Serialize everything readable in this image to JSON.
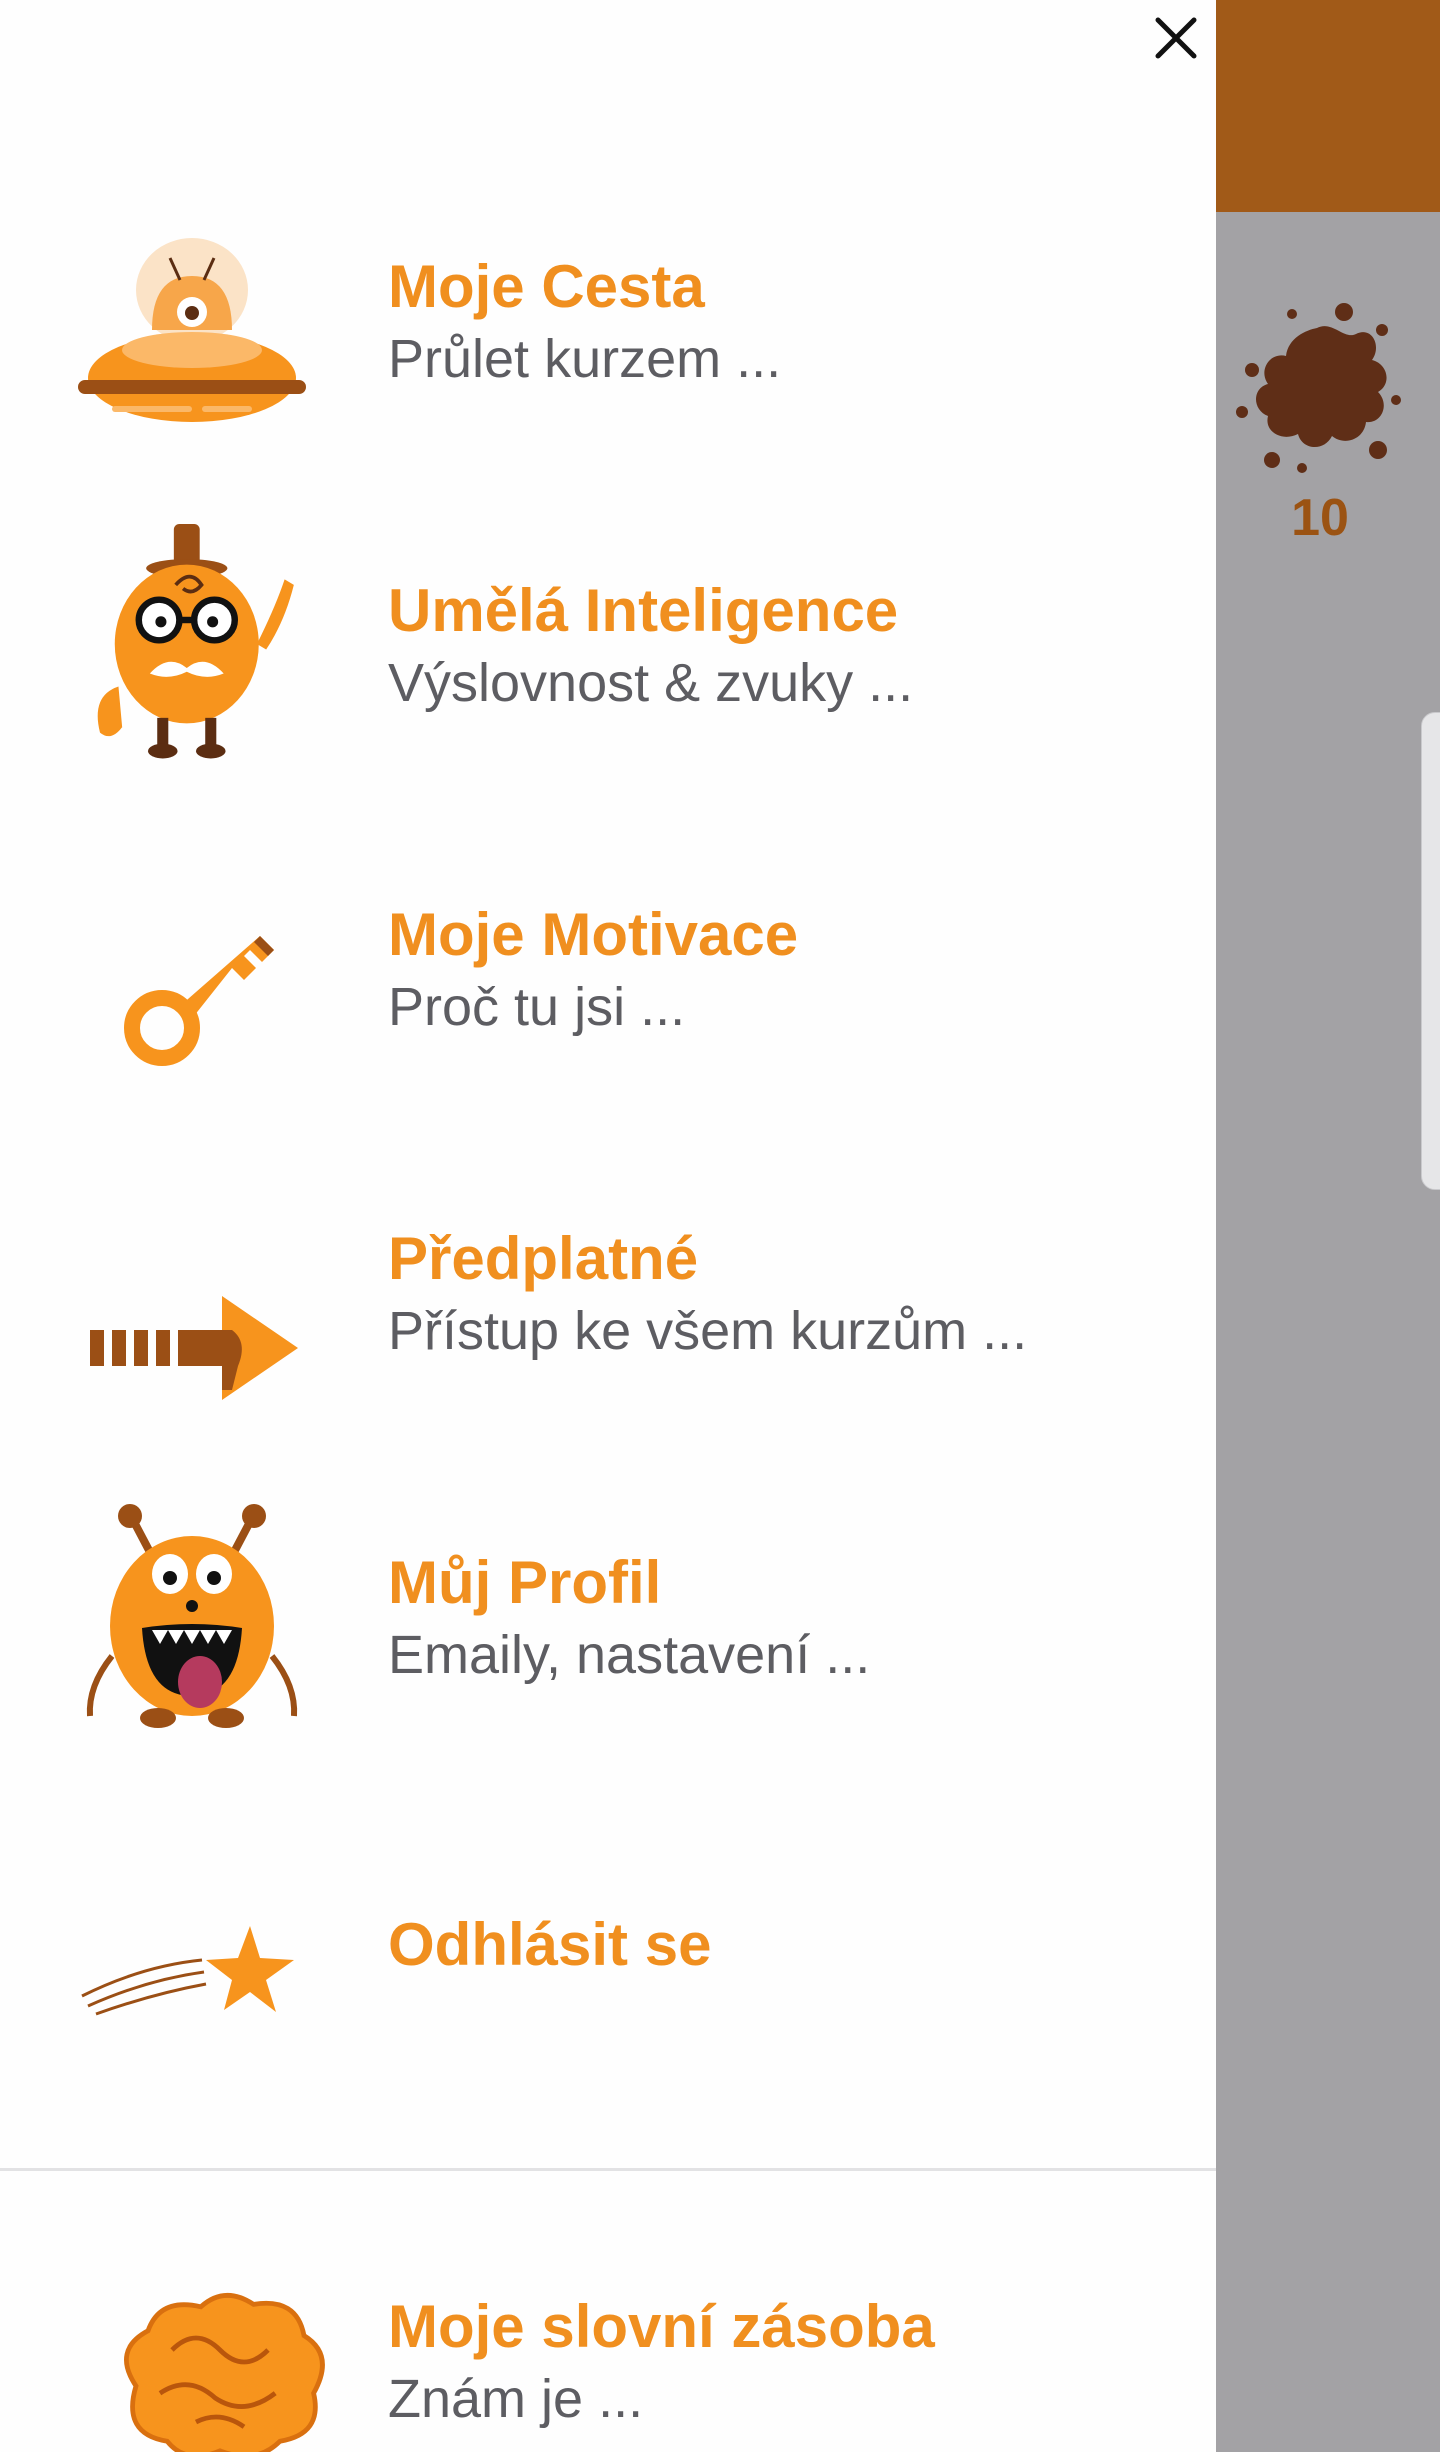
{
  "background": {
    "count": "10",
    "topbar_color": "#a15a18",
    "splat_color": "#5f2e17"
  },
  "drawer": {
    "close_icon": "close-icon",
    "accent_color": "#f08f1f",
    "subtitle_color": "#5d5d62",
    "items": [
      {
        "title": "Moje Cesta",
        "subtitle": "Průlet kurzem ...",
        "icon": "ufo-alien-icon"
      },
      {
        "title": "Umělá Inteligence",
        "subtitle": "Výslovnost & zvuky ...",
        "icon": "professor-monster-icon"
      },
      {
        "title": "Moje Motivace",
        "subtitle": "Proč tu jsi ...",
        "icon": "key-icon"
      },
      {
        "title": "Předplatné",
        "subtitle": "Přístup ke všem kurzům ...",
        "icon": "arrow-right-icon"
      },
      {
        "title": "Můj Profil",
        "subtitle": "Emaily, nastavení ...",
        "icon": "monster-icon"
      },
      {
        "title": "Odhlásit se",
        "icon": "shooting-star-icon"
      },
      {
        "title": "Moje slovní zásoba",
        "subtitle": "Znám je ...",
        "icon": "brain-icon"
      }
    ]
  }
}
